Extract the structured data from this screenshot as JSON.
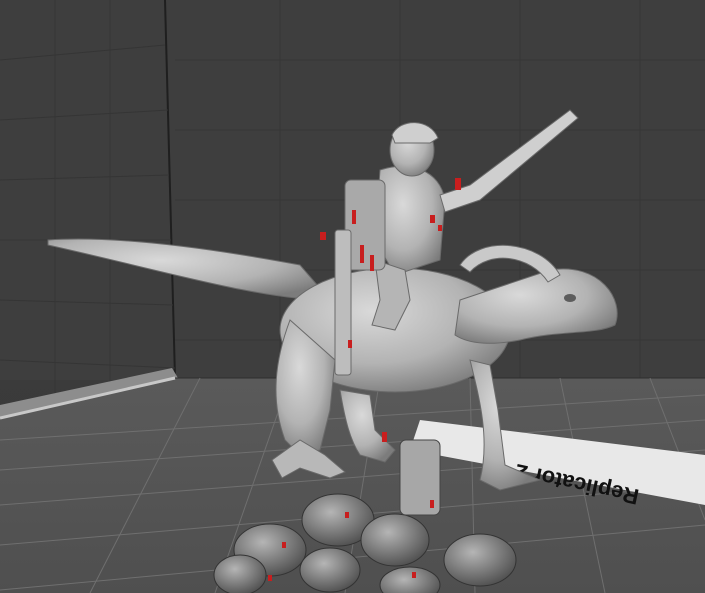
{
  "viewport": {
    "background": "#3c3c3c",
    "grid_color": "#6f6f6f",
    "floor_color": "#575757",
    "wall_color": "#3e3e3e",
    "highlight_color": "#d02020"
  },
  "build_plate": {
    "label_text": "Replicator 2"
  },
  "model": {
    "icon": "dinosaur-rider-miniature-icon",
    "support_markers_color": "#c81e1e"
  }
}
